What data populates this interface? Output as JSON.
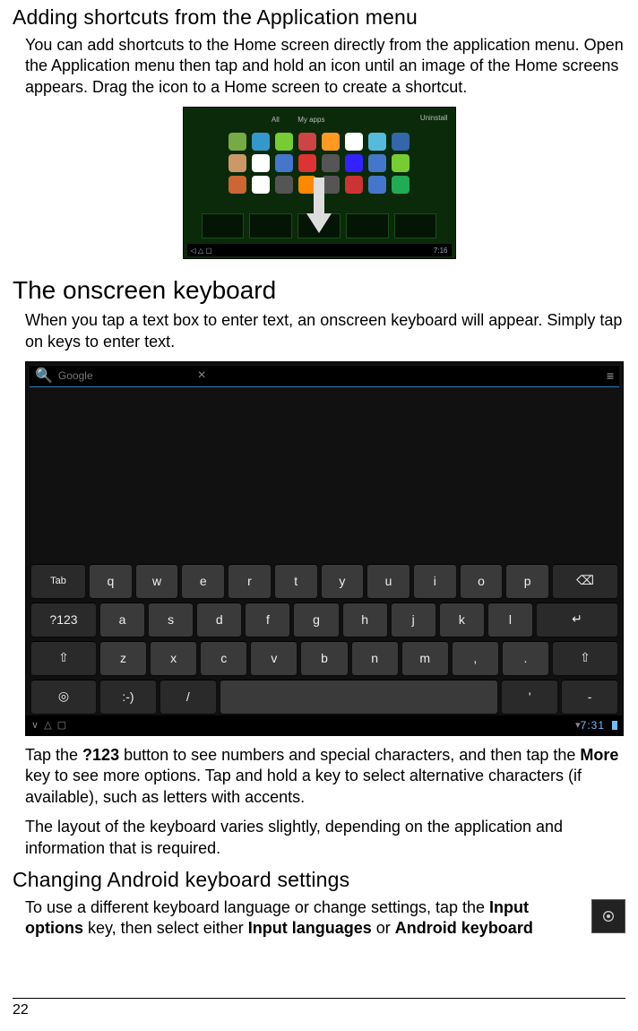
{
  "page_number": "22",
  "sections": {
    "adding": {
      "title": "Adding shortcuts from the Application menu",
      "body": "You can add shortcuts to the Home screen directly from the application menu. Open the Application menu then tap and hold an icon until an image of the Home screens appears. Drag the icon to a Home screen to create a shortcut."
    },
    "onscreen": {
      "title": "The onscreen keyboard",
      "body": "When you tap a text box to enter text, an onscreen keyboard will appear. Simply tap on keys to enter text."
    },
    "tap_para": {
      "pre": "Tap the ",
      "key1": "?123",
      "mid1": " button to see numbers and special characters, and then tap the ",
      "key2": "More",
      "mid2": " key to see more options. Tap and hold a key to select alternative characters (if available), such as letters with accents."
    },
    "layout_para": "The layout of the keyboard varies slightly, depending on the application and information that is required.",
    "changing": {
      "title": "Changing Android keyboard settings",
      "pre": "To use a different keyboard language or change settings, tap the ",
      "k1": "Input options",
      "mid": " key, then select either ",
      "k2": "Input languages",
      "or": " or ",
      "k3": "Android keyboard"
    }
  },
  "fig1": {
    "tabs": [
      "All",
      "My apps"
    ],
    "uninstall": "Uninstall",
    "clock": "7:16",
    "icon_colors": [
      [
        "#7a4",
        "#39c",
        "#7c3",
        "#c44",
        "#f92",
        "#fff",
        "#5bd",
        "#36a"
      ],
      [
        "#c96",
        "#fff",
        "#47c",
        "#d33",
        "#555",
        "#32f",
        "#47c",
        "#7c3"
      ],
      [
        "#c63",
        "#fff",
        "#555",
        "#f80",
        "#555",
        "#c33",
        "#47c",
        "#2a5"
      ]
    ],
    "dock_cells": 5
  },
  "keyboard": {
    "placeholder": "Google",
    "rows": {
      "r1": [
        "q",
        "w",
        "e",
        "r",
        "t",
        "y",
        "u",
        "i",
        "o",
        "p"
      ],
      "r2": [
        "a",
        "s",
        "d",
        "f",
        "g",
        "h",
        "j",
        "k",
        "l"
      ],
      "r3": [
        "z",
        "x",
        "c",
        "v",
        "b",
        "n",
        "m",
        ",",
        "."
      ]
    },
    "tab": "Tab",
    "num": "?123",
    "shift": "⇧",
    "back": "⌫",
    "enter": "↵",
    "globe": "◎",
    "smile": ":-)",
    "slash": "/",
    "apos": "'",
    "dash": "-",
    "space": "",
    "clock": "7:31"
  }
}
